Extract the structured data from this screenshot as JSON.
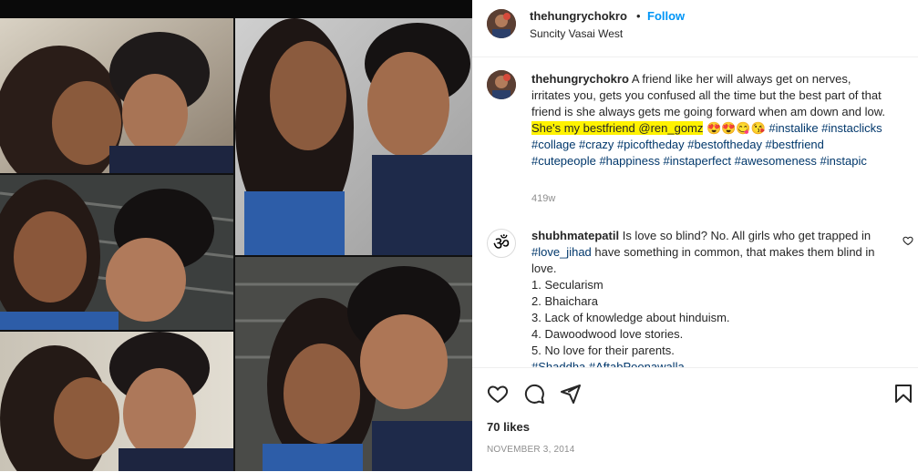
{
  "post": {
    "photo_alt": "Collage of five selfies",
    "username": "thehungrychokro",
    "separator": "•",
    "follow_label": "Follow",
    "location": "Suncity Vasai West"
  },
  "caption": {
    "username": "thehungrychokro",
    "text_plain": "A friend like her will always get on nerves, irritates you, gets you confused all the time but the best part of that friend is she always gets me going forward when am down and low.",
    "text_highlight": "She's my bestfriend @ren_gomz",
    "emojis": "😍😍😋😘",
    "hashtags": "#instalike #instaclicks #collage #crazy #picoftheday #bestoftheday #bestfriend #cutepeople #happiness #instaperfect #awesomeness #instapic",
    "time": "419w"
  },
  "comment": {
    "username": "shubhmatepatil",
    "avatar_symbol": "ॐ",
    "text_start": "Is love so blind? No. All girls who get trapped in",
    "hashtag": "#love_jihad",
    "text_end": "have something in common, that makes them blind in love.",
    "items": [
      "1. Secularism",
      "2. Bhaichara",
      "3. Lack of knowledge about hinduism.",
      "4. Dawoodwood love stories.",
      "5. No love for their parents."
    ],
    "cut_text": "#Shaddha #AftabPoonawalla"
  },
  "actions": {
    "likes": "70 likes",
    "date": "NOVEMBER 3, 2014"
  },
  "colors": {
    "link_blue": "#0095f6",
    "hashtag_blue": "#00376b",
    "highlight": "#fff200",
    "muted": "#8e8e8e"
  },
  "icons": [
    "heart-icon",
    "comment-icon",
    "share-icon",
    "bookmark-icon",
    "comment-like-heart-icon"
  ]
}
